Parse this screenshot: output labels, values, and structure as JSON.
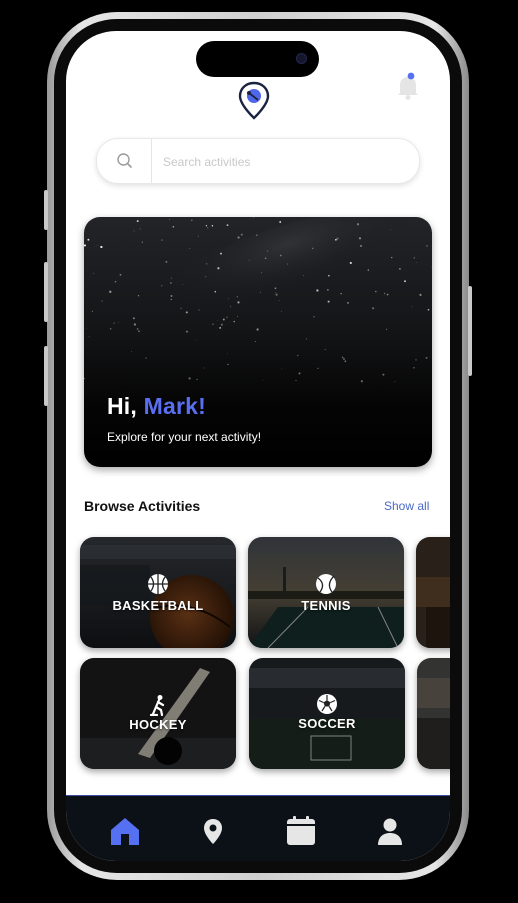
{
  "header": {
    "logo_icon": "location-pin-logo-icon",
    "notification_icon": "bell-icon"
  },
  "search": {
    "placeholder": "Search activities",
    "icon": "search-icon"
  },
  "hero": {
    "greeting_prefix": "Hi, ",
    "user_name": "Mark!",
    "subtitle": "Explore for your next activity!"
  },
  "browse": {
    "title": "Browse Activities",
    "show_all": "Show all",
    "activities": [
      {
        "label": "BASKETBALL",
        "icon": "basketball-icon"
      },
      {
        "label": "TENNIS",
        "icon": "tennis-ball-icon"
      },
      {
        "label": "HOCKEY",
        "icon": "hockey-player-icon"
      },
      {
        "label": "SOCCER",
        "icon": "soccer-ball-icon"
      }
    ]
  },
  "tabbar": {
    "items": [
      {
        "name": "home",
        "icon": "home-icon",
        "active": true
      },
      {
        "name": "map",
        "icon": "map-pin-icon",
        "active": false
      },
      {
        "name": "calendar",
        "icon": "calendar-icon",
        "active": false
      },
      {
        "name": "profile",
        "icon": "user-icon",
        "active": false
      }
    ]
  },
  "colors": {
    "accent": "#5a6ff0",
    "link": "#4a68c8",
    "tabbar_bg": "#0c1118",
    "active_tab": "#5670f2",
    "inactive_tab": "#e6e6e6"
  }
}
